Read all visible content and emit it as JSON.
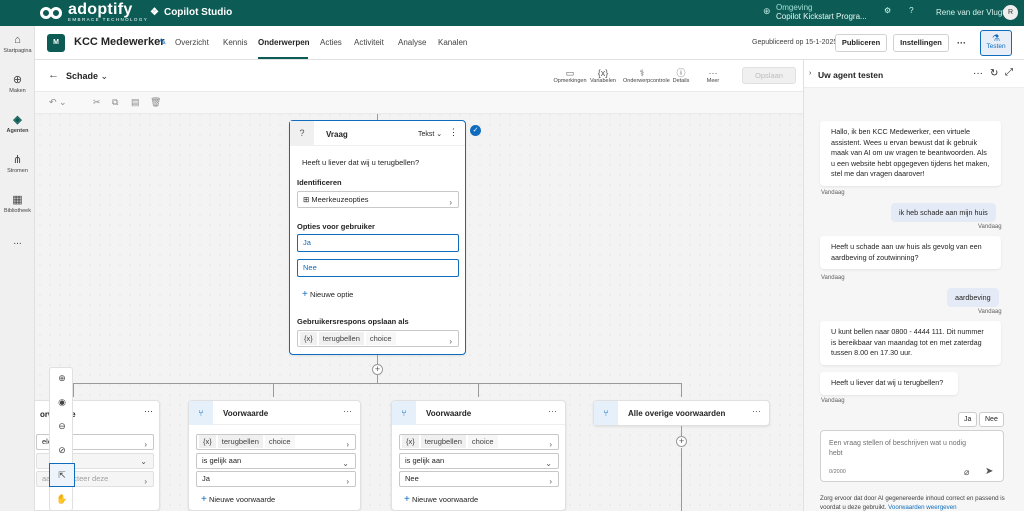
{
  "brand": {
    "name": "adoptify",
    "tagline": "EMBRACE TECHNOLOGY",
    "product": "Copilot Studio"
  },
  "environment": {
    "label": "Omgeving",
    "value": "Copilot Kickstart Progra..."
  },
  "user": {
    "name": "Rene van der Vlugt",
    "initial": "R"
  },
  "rail": {
    "items": [
      {
        "label": "Startpagina",
        "icon": "home-icon"
      },
      {
        "label": "Maken",
        "icon": "add-icon"
      },
      {
        "label": "Agenten",
        "icon": "agents-icon"
      },
      {
        "label": "Stromen",
        "icon": "flows-icon"
      },
      {
        "label": "Bibliotheek",
        "icon": "library-icon"
      },
      {
        "label": "...",
        "icon": "more-icon"
      }
    ]
  },
  "agent": {
    "name": "KCC Medewerker",
    "tabs": [
      "Overzicht",
      "Kennis",
      "Onderwerpen",
      "Acties",
      "Activiteit",
      "Analyse",
      "Kanalen"
    ],
    "active_tab": "Onderwerpen",
    "published": "Gepubliceerd op 15-1-2025",
    "publish_btn": "Publiceren",
    "settings_btn": "Instellingen",
    "more": "···",
    "test_btn": "Testen"
  },
  "topic": {
    "name": "Schade",
    "tools": [
      "Opmerkingen",
      "Variabelen",
      "Onderwerpcontrole",
      "Details",
      "Meer"
    ],
    "save_btn": "Opslaan"
  },
  "question_node": {
    "header": "Vraag",
    "type": "Tekst",
    "prompt": "Heeft u liever dat wij u terugbellen?",
    "identify_label": "Identificeren",
    "identify_value": "Meerkeuzeopties",
    "options_label": "Opties voor gebruiker",
    "options": [
      "Ja",
      "Nee"
    ],
    "new_option": "Nieuwe optie",
    "save_label": "Gebruikersrespons opslaan als",
    "var_symbol": "{x}",
    "var_name": "terugbellen",
    "var_type": "choice"
  },
  "branches": {
    "partial": {
      "header": "orwaarde",
      "field1": "ele s   en",
      "field3": "aarde   electeer deze"
    },
    "cond1": {
      "header": "Voorwaarde",
      "var": "terugbellen",
      "type": "choice",
      "op": "is gelijk aan",
      "value": "Ja",
      "add": "Nieuwe voorwaarde"
    },
    "cond2": {
      "header": "Voorwaarde",
      "var": "terugbellen",
      "type": "choice",
      "op": "is gelijk aan",
      "value": "Nee",
      "add": "Nieuwe voorwaarde"
    },
    "other": {
      "header": "Alle overige voorwaarden"
    }
  },
  "test_pane": {
    "title": "Uw agent testen",
    "messages": [
      {
        "from": "bot",
        "text": "Hallo, ik ben KCC Medewerker, een virtuele assistent. Wees u ervan bewust dat ik gebruik maak van AI om uw vragen te beantwoorden. Als u een website hebt opgegeven tijdens het maken, stel me dan vragen daarover!",
        "time": "Vandaag"
      },
      {
        "from": "user",
        "text": "ik heb schade aan mijn huis",
        "time": "Vandaag"
      },
      {
        "from": "bot",
        "text": "Heeft u schade aan uw huis als gevolg van een aardbeving of zoutwinning?",
        "time": "Vandaag"
      },
      {
        "from": "user",
        "text": "aardbeving",
        "time": "Vandaag"
      },
      {
        "from": "bot",
        "text": "U kunt bellen naar 0800 - 4444 111. Dit nummer is bereikbaar van maandag tot en met zaterdag tussen 8.00 en 17.30 uur.",
        "time": ""
      },
      {
        "from": "bot",
        "text": "Heeft u liever dat wij u terugbellen?",
        "time": "Vandaag"
      }
    ],
    "quick_replies": [
      "Ja",
      "Nee"
    ],
    "input_placeholder": "Een vraag stellen of beschrijven wat u nodig hebt",
    "char_count": "0/2000",
    "disclaimer": "Zorg ervoor dat door AI gegenereerde inhoud correct en passend is voordat u deze gebruikt.",
    "disclaimer_link": "Voorwaarden weergeven"
  },
  "colors": {
    "brand": "#0d5b55",
    "accent": "#0f6cbd"
  }
}
